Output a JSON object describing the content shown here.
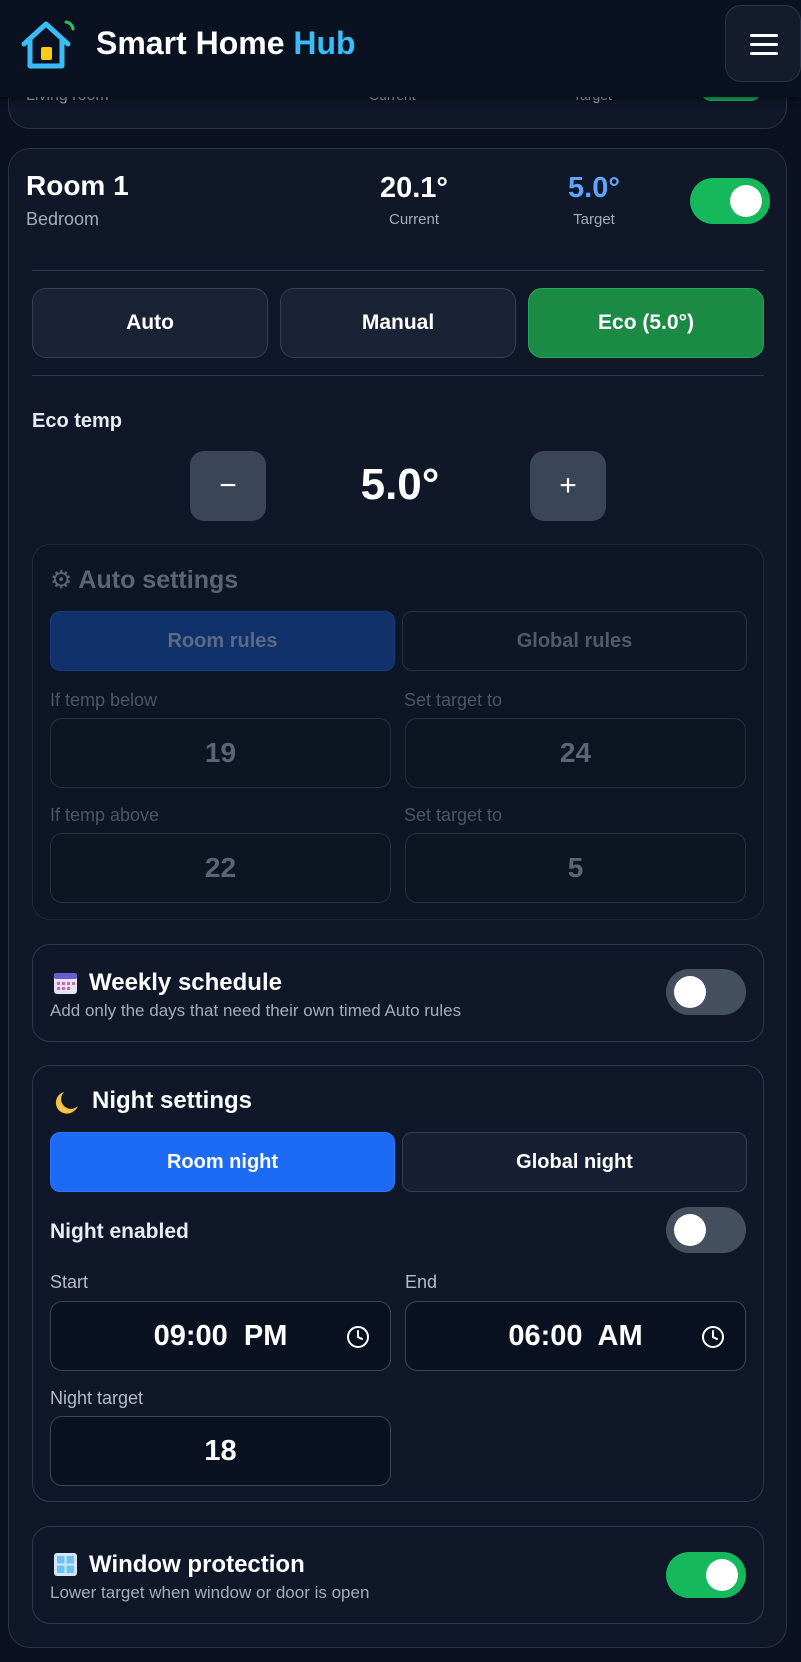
{
  "header": {
    "title_main": "Smart Home",
    "title_accent": "Hub"
  },
  "prev_room": {
    "sub": "Living room",
    "current_label": "Current",
    "target_label": "Target"
  },
  "room": {
    "name": "Room 1",
    "sub": "Bedroom",
    "current_value": "20.1°",
    "current_label": "Current",
    "target_value": "5.0°",
    "target_label": "Target",
    "power_on": true
  },
  "modes": [
    "Auto",
    "Manual",
    "Eco (5.0°)"
  ],
  "active_mode": "Eco (5.0°)",
  "eco": {
    "label": "Eco temp",
    "minus": "−",
    "value": "5.0°",
    "plus": "+"
  },
  "auto_settings": {
    "icon": "gear-icon",
    "title": "⚙ Auto settings",
    "tabs": [
      "Room rules",
      "Global rules"
    ],
    "if_below_label": "If temp below",
    "if_below_value": "19",
    "set_target_label_1": "Set target to",
    "set_target_value_1": "24",
    "if_above_label": "If temp above",
    "if_above_value": "22",
    "set_target_label_2": "Set target to",
    "set_target_value_2": "5"
  },
  "weekly": {
    "icon": "calendar-icon",
    "title": "Weekly schedule",
    "sub": "Add only the days that need their own timed Auto rules",
    "enabled": false
  },
  "night": {
    "icon": "moon-icon",
    "title": "Night settings",
    "tabs": [
      "Room night",
      "Global night"
    ],
    "enabled_label": "Night enabled",
    "enabled": false,
    "start_label": "Start",
    "start_value": "09:00  PM",
    "end_label": "End",
    "end_value": "06:00  AM",
    "target_label": "Night target",
    "target_value": "18"
  },
  "window": {
    "icon": "window-icon",
    "title": "Window protection",
    "sub": "Lower target when window or door is open",
    "enabled": true
  },
  "colors": {
    "accent": "#38bdf8",
    "target": "#60a5fa",
    "on": "#16b85c",
    "primary": "#1d6af5",
    "eco": "#1a8a45"
  }
}
